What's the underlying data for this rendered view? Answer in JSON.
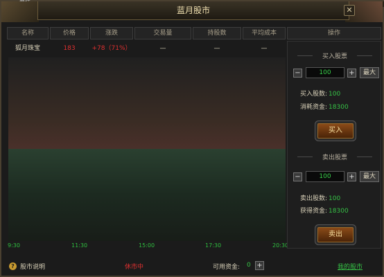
{
  "top_tab": "竞技",
  "window": {
    "title": "蓝月股市",
    "close_label": "✕"
  },
  "columns": [
    "名称",
    "价格",
    "涨跌",
    "交易量",
    "持股数",
    "平均成本"
  ],
  "operation_header": "操作",
  "row": {
    "name": "狐月珠宝",
    "price": "183",
    "change": "+78（71%）",
    "volume": "—",
    "holdings": "—",
    "avg_cost": "—"
  },
  "chart_data": {
    "type": "area",
    "x_ticks": [
      "9:30",
      "11:30",
      "15:00",
      "17:30",
      "20:30"
    ],
    "x": [],
    "y": []
  },
  "buy": {
    "title": "买入股票",
    "minus": "−",
    "plus": "+",
    "qty": "100",
    "max_label": "最大",
    "shares_label": "买入股数:",
    "shares_value": "100",
    "cost_label": "消耗资金:",
    "cost_value": "18300",
    "button_label": "买入"
  },
  "sell": {
    "title": "卖出股票",
    "minus": "−",
    "plus": "+",
    "qty": "100",
    "max_label": "最大",
    "shares_label": "卖出股数:",
    "shares_value": "100",
    "gain_label": "获得资金:",
    "gain_value": "18300",
    "button_label": "卖出"
  },
  "footer": {
    "help_icon": "?",
    "help_label": "股市说明",
    "status": "休市中",
    "funds_label": "可用资金:",
    "funds_value": "0",
    "add_label": "+",
    "my_stocks_link": "我的股市"
  },
  "colors": {
    "up": "#e03030",
    "green": "#36c246",
    "gold": "#c89a30"
  }
}
